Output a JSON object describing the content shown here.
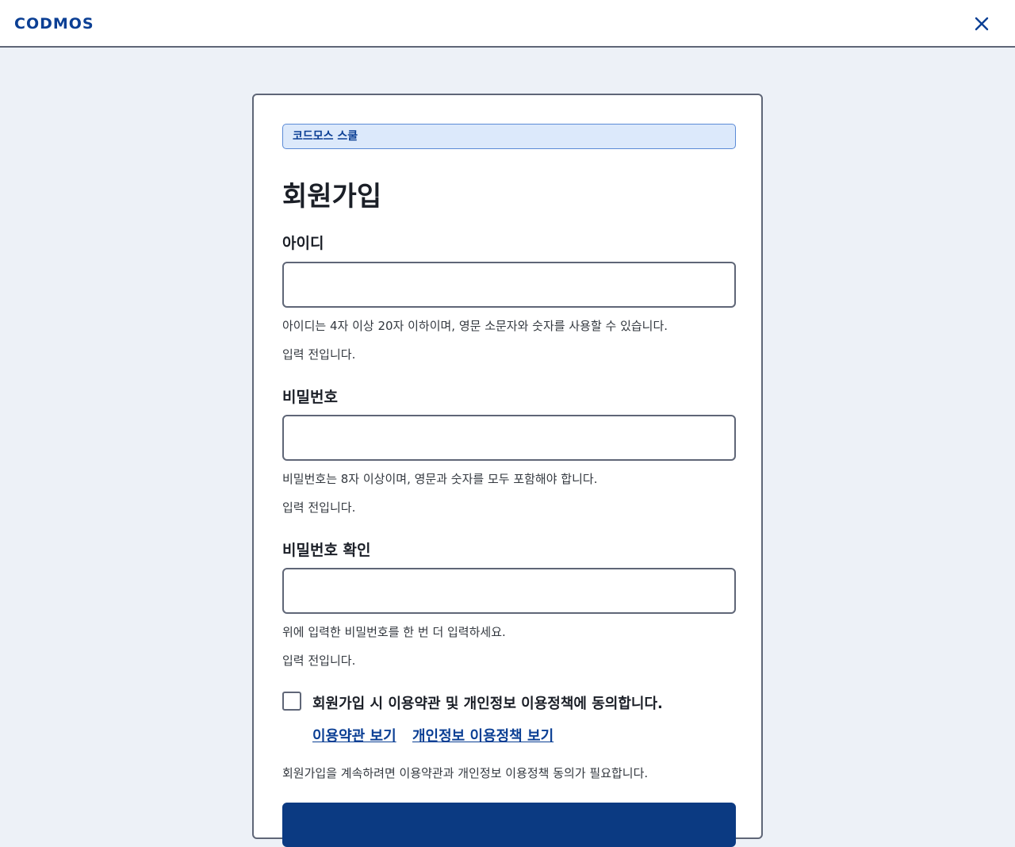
{
  "header": {
    "logo": "CODMOS",
    "close_icon": "close-icon",
    "brand_color": "#0b3f94"
  },
  "form": {
    "badge": "코드모스 스쿨",
    "title": "회원가입",
    "username": {
      "label": "아이디",
      "value": "",
      "help": "아이디는 4자 이상 20자 이하이며, 영문 소문자와 숫자를 사용할 수 있습니다.",
      "status": "입력 전입니다."
    },
    "password": {
      "label": "비밀번호",
      "value": "",
      "help": "비밀번호는 8자 이상이며, 영문과 숫자를 모두 포함해야 합니다.",
      "status": "입력 전입니다."
    },
    "password_confirm": {
      "label": "비밀번호 확인",
      "value": "",
      "help": "위에 입력한 비밀번호를 한 번 더 입력하세요.",
      "status": "입력 전입니다."
    },
    "agreement": {
      "label": "회원가입 시 이용약관 및 개인정보 이용정책에 동의합니다.",
      "checked": false,
      "terms_link": "이용약관 보기",
      "privacy_link": "개인정보 이용정책 보기",
      "note": "회원가입을 계속하려면 이용약관과 개인정보 이용정책 동의가 필요합니다."
    },
    "submit_label": ""
  }
}
